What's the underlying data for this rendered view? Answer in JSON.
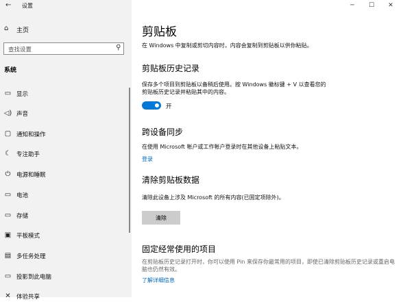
{
  "window": {
    "title": "设置",
    "minimize_glyph": "─",
    "maximize_glyph": "☐",
    "close_glyph": "✕"
  },
  "sidebar": {
    "back_glyph": "←",
    "home_label": "主页",
    "search_placeholder": "查找设置",
    "section": "系统",
    "items": [
      {
        "label": "显示",
        "icon": "display-icon",
        "glyph": "▭"
      },
      {
        "label": "声音",
        "icon": "sound-icon",
        "glyph": "◁)"
      },
      {
        "label": "通知和操作",
        "icon": "notifications-icon",
        "glyph": "▢"
      },
      {
        "label": "专注助手",
        "icon": "focus-assist-icon",
        "glyph": "☾"
      },
      {
        "label": "电源和睡眠",
        "icon": "power-icon",
        "glyph": "⏻"
      },
      {
        "label": "电池",
        "icon": "battery-icon",
        "glyph": "▭"
      },
      {
        "label": "存储",
        "icon": "storage-icon",
        "glyph": "▭"
      },
      {
        "label": "平板模式",
        "icon": "tablet-mode-icon",
        "glyph": "▣"
      },
      {
        "label": "多任务处理",
        "icon": "multitasking-icon",
        "glyph": "▤"
      },
      {
        "label": "投影到此电脑",
        "icon": "projecting-icon",
        "glyph": "▭"
      },
      {
        "label": "体验共享",
        "icon": "shared-experiences-icon",
        "glyph": "✕"
      }
    ]
  },
  "main": {
    "title": "剪贴板",
    "intro": "在 Windows 中复制或剪切内容时，内容会复制到剪贴板以供你粘贴。",
    "history": {
      "heading": "剪贴板历史记录",
      "desc": "保存多个项目到剪贴板以备稍后使用。按 Windows 徽标键 + V 以查看您的剪贴板历史记录并粘贴其中的内容。",
      "toggle_state": "开",
      "toggle_on": true
    },
    "sync": {
      "heading": "跨设备同步",
      "desc": "在使用 Microsoft 帐户或工作帐户登录时在其他设备上粘贴文本。",
      "link": "登录"
    },
    "clear": {
      "heading": "清除剪贴板数据",
      "desc": "清除此设备上涉及 Microsoft 的所有内容(已固定项除外)。",
      "button": "清除"
    },
    "pinned": {
      "heading": "固定经常使用的项目",
      "desc": "在剪贴板历史记录打开时，你可以使用 Pin 来保存你最常用的项目，即使已清除剪贴板历史记录或重启电脑也仍然有效。",
      "link": "了解详细信息"
    }
  },
  "colors": {
    "accent": "#0078d7",
    "link": "#0067b8",
    "sidebar_bg": "#f2f2f2"
  }
}
